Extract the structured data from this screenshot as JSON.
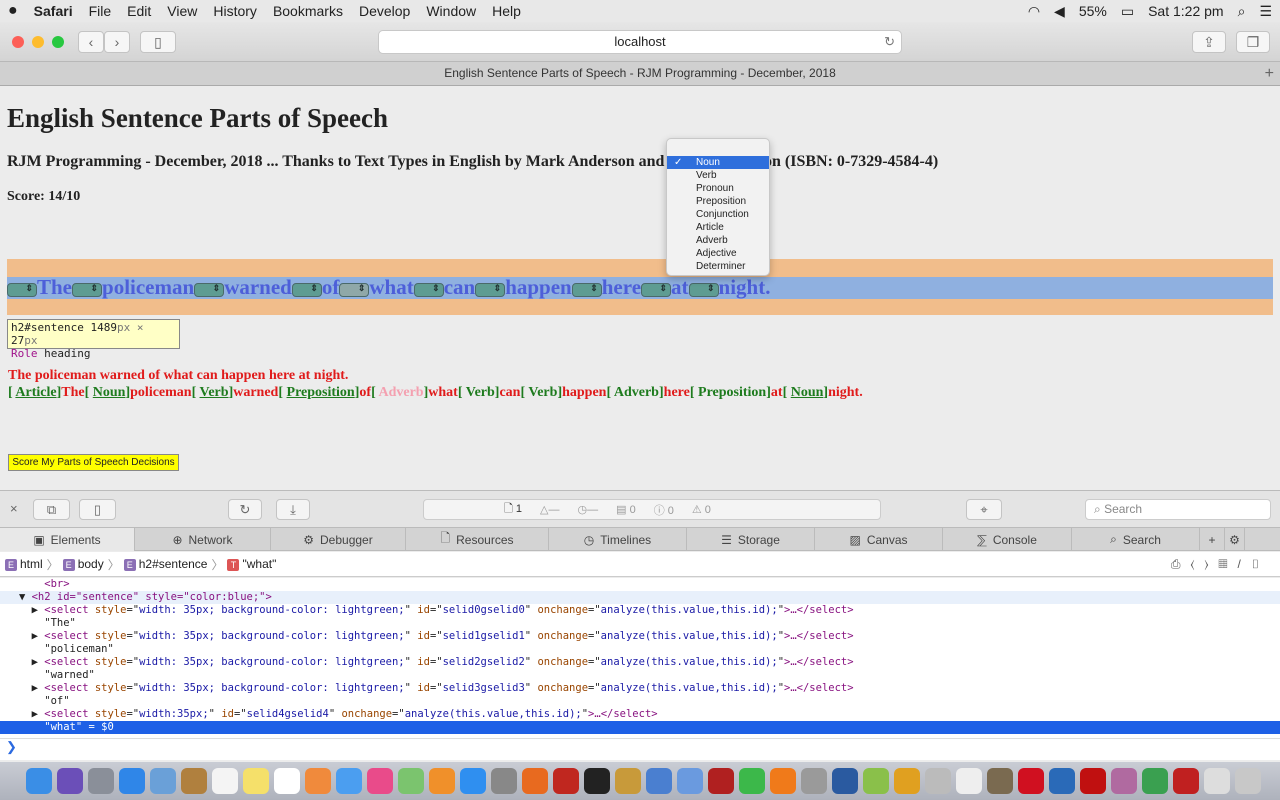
{
  "menubar": {
    "apple": "",
    "app": "Safari",
    "items": [
      "File",
      "Edit",
      "View",
      "History",
      "Bookmarks",
      "Develop",
      "Window",
      "Help"
    ],
    "battery": "55%",
    "clock": "Sat 1:22 pm"
  },
  "browser": {
    "url": "localhost",
    "tab_title": "English Sentence Parts of Speech - RJM Programming - December, 2018"
  },
  "page": {
    "title": "English Sentence Parts of Speech",
    "subtitle": "RJM Programming - December, 2018 ... Thanks to Text Types in English by Mark Anderson and Kathy Anderson (ISBN: 0-7329-4584-4)",
    "score": "Score: 14/10",
    "words": [
      "The",
      "policeman",
      "warned",
      "of",
      "what",
      "can",
      "happen",
      "here",
      "at",
      "night."
    ],
    "tooltip": {
      "selector": "h2#sentence",
      "w": "1489",
      "h": "27",
      "unit": "px",
      "x": "×",
      "role_label": "Role",
      "role": "heading"
    },
    "plain_sentence": "The policeman warned of what can happen here at night.",
    "answers": [
      {
        "label": "Article",
        "word": "The",
        "style": "u"
      },
      {
        "label": "Noun",
        "word": "policeman",
        "style": "u"
      },
      {
        "label": "Verb",
        "word": "warned",
        "style": "u"
      },
      {
        "label": "Preposition",
        "word": "of",
        "style": "u"
      },
      {
        "label": "Adverb",
        "word": "what",
        "style": "pink"
      },
      {
        "label": "Verb",
        "word": "can",
        "style": ""
      },
      {
        "label": "Verb",
        "word": "happen",
        "style": ""
      },
      {
        "label": "Adverb",
        "word": "here",
        "style": ""
      },
      {
        "label": "Preposition",
        "word": "at",
        "style": ""
      },
      {
        "label": "Noun",
        "word": "night.",
        "style": "u"
      }
    ],
    "score_button": "Score My Parts of Speech Decisions",
    "dropdown": {
      "selected": "Noun",
      "options": [
        "Noun",
        "Verb",
        "Pronoun",
        "Preposition",
        "Conjunction",
        "Article",
        "Adverb",
        "Adjective",
        "Determiner"
      ]
    }
  },
  "devtools": {
    "dashboard": {
      "resources": "1",
      "logs": "0",
      "errors": "0",
      "warnings": "0"
    },
    "search_placeholder": "Search",
    "tabs": [
      "Elements",
      "Network",
      "Debugger",
      "Resources",
      "Timelines",
      "Storage",
      "Canvas",
      "Console",
      "Search"
    ],
    "breadcrumbs": [
      {
        "badge": "E",
        "label": "html"
      },
      {
        "badge": "E",
        "label": "body"
      },
      {
        "badge": "E",
        "label": "h2#sentence"
      },
      {
        "badge": "T",
        "label": "\"what\""
      }
    ],
    "code": [
      {
        "indent": "       ",
        "kind": "tag",
        "text": "<br>"
      },
      {
        "indent": "   ▼ ",
        "kind": "h2",
        "text": "<h2 id=\"sentence\" style=\"color:blue;\">"
      },
      {
        "indent": "     ▶ ",
        "kind": "select",
        "id": "selid0gselid0",
        "style": "width: 35px; background-color: lightgreen;"
      },
      {
        "indent": "       ",
        "kind": "text",
        "text": "\"The\""
      },
      {
        "indent": "     ▶ ",
        "kind": "select",
        "id": "selid1gselid1",
        "style": "width: 35px; background-color: lightgreen;"
      },
      {
        "indent": "       ",
        "kind": "text",
        "text": "\"policeman\""
      },
      {
        "indent": "     ▶ ",
        "kind": "select",
        "id": "selid2gselid2",
        "style": "width: 35px; background-color: lightgreen;"
      },
      {
        "indent": "       ",
        "kind": "text",
        "text": "\"warned\""
      },
      {
        "indent": "     ▶ ",
        "kind": "select",
        "id": "selid3gselid3",
        "style": "width: 35px; background-color: lightgreen;"
      },
      {
        "indent": "       ",
        "kind": "text",
        "text": "\"of\""
      },
      {
        "indent": "     ▶ ",
        "kind": "select",
        "id": "selid4gselid4",
        "style": "width:35px;"
      },
      {
        "indent": "       ",
        "kind": "cur",
        "text": "\"what\" = $0"
      }
    ],
    "onchange": "analyze(this.value,this.id);",
    "console_prompt": "❯"
  },
  "dock": {
    "icons": [
      [
        "finder",
        "#3a8ee6"
      ],
      [
        "siri",
        "#6b4fb8"
      ],
      [
        "launchpad",
        "#8a8f99"
      ],
      [
        "safari",
        "#2f86e8"
      ],
      [
        "preview",
        "#6aa0d8"
      ],
      [
        "notes-book",
        "#b0803e"
      ],
      [
        "calendar",
        "#f4f4f4"
      ],
      [
        "stickies",
        "#f5e06a"
      ],
      [
        "reminders",
        "#ffffff"
      ],
      [
        "photos",
        "#f08a3c"
      ],
      [
        "messages",
        "#4b9ef0"
      ],
      [
        "itunes",
        "#e94b8a"
      ],
      [
        "maps",
        "#7bc46e"
      ],
      [
        "ibooks",
        "#f0902a"
      ],
      [
        "appstore",
        "#2f8ff0"
      ],
      [
        "prefs",
        "#888888"
      ],
      [
        "firefox",
        "#e86a1f"
      ],
      [
        "filezilla",
        "#c0271f"
      ],
      [
        "terminal",
        "#222222"
      ],
      [
        "textwrangler",
        "#c89a3a"
      ],
      [
        "xcode",
        "#4a7fd0"
      ],
      [
        "mail",
        "#6a9adf"
      ],
      [
        "photobooth",
        "#b02020"
      ],
      [
        "facetime",
        "#3cb84a"
      ],
      [
        "avast",
        "#f07a1a"
      ],
      [
        "utility",
        "#9a9a9a"
      ],
      [
        "quicktime",
        "#2a5aa0"
      ],
      [
        "android",
        "#8ac04a"
      ],
      [
        "app",
        "#e0a020"
      ],
      [
        "app2",
        "#bbbbbb"
      ],
      [
        "doc",
        "#eeeeee"
      ],
      [
        "gimp",
        "#7a6a50"
      ],
      [
        "opera",
        "#d01020"
      ],
      [
        "vscode",
        "#2a6ab8"
      ],
      [
        "acrobat",
        "#c01010"
      ],
      [
        "geogebra",
        "#b06aa0"
      ],
      [
        "chrome",
        "#3aa050"
      ],
      [
        "app3",
        "#c02020"
      ],
      [
        "scanner",
        "#dddddd"
      ],
      [
        "trash",
        "#c8c8c8"
      ]
    ]
  }
}
